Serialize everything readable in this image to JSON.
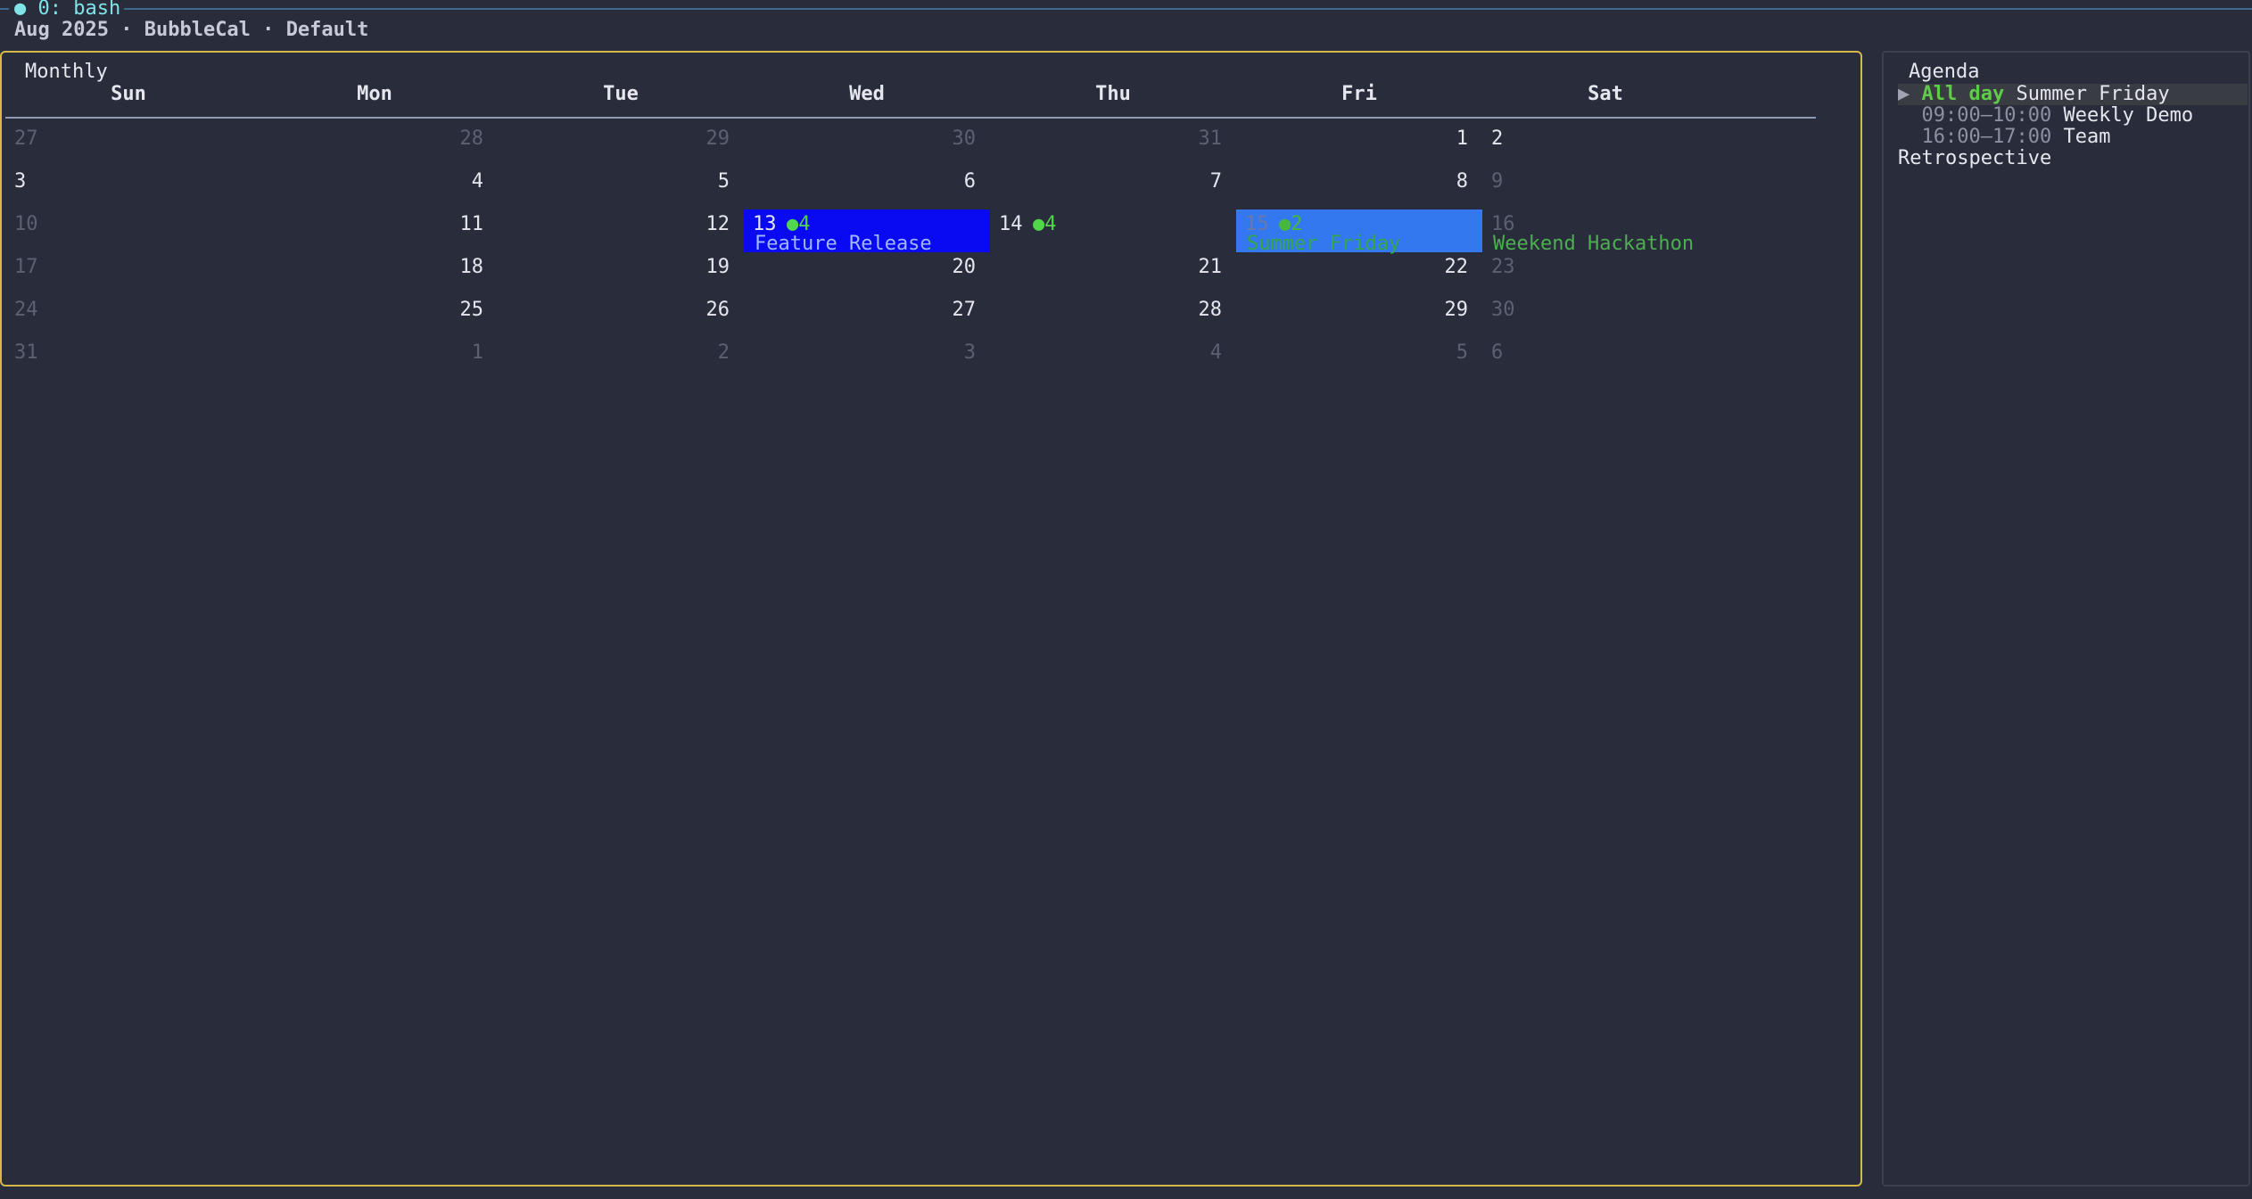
{
  "tmux": {
    "dot": "●",
    "label": "0: bash"
  },
  "status": {
    "month": "Aug 2025",
    "app": "BubbleCal",
    "profile": "Default",
    "sep": " · "
  },
  "calendar": {
    "title": "Monthly",
    "weekdays": [
      "Sun",
      "Mon",
      "Tue",
      "Wed",
      "Thu",
      "Fri",
      "Sat"
    ],
    "weeks": [
      [
        {
          "day": "27",
          "muted": true
        },
        {
          "day": "28",
          "muted": true
        },
        {
          "day": "29",
          "muted": true
        },
        {
          "day": "30",
          "muted": true
        },
        {
          "day": "31",
          "muted": true
        },
        {
          "day": "1"
        },
        {
          "day": "2"
        }
      ],
      [
        {
          "day": "3"
        },
        {
          "day": "4"
        },
        {
          "day": "5"
        },
        {
          "day": "6"
        },
        {
          "day": "7"
        },
        {
          "day": "8"
        },
        {
          "day": "9",
          "muted": true
        }
      ],
      [
        {
          "day": "10",
          "muted": true
        },
        {
          "day": "11"
        },
        {
          "day": "12"
        },
        {
          "day": "13",
          "count": "●4",
          "event": "Feature Release",
          "state": "selected"
        },
        {
          "day": "14",
          "count": "●4"
        },
        {
          "day": "15",
          "count": "●2",
          "event": "Summer Friday",
          "state": "today"
        },
        {
          "day": "16",
          "muted": true,
          "event": "Weekend Hackathon"
        }
      ],
      [
        {
          "day": "17",
          "muted": true
        },
        {
          "day": "18"
        },
        {
          "day": "19"
        },
        {
          "day": "20"
        },
        {
          "day": "21"
        },
        {
          "day": "22"
        },
        {
          "day": "23",
          "muted": true
        }
      ],
      [
        {
          "day": "24",
          "muted": true
        },
        {
          "day": "25"
        },
        {
          "day": "26"
        },
        {
          "day": "27"
        },
        {
          "day": "28"
        },
        {
          "day": "29"
        },
        {
          "day": "30",
          "muted": true
        }
      ],
      [
        {
          "day": "31",
          "muted": true
        },
        {
          "day": "1",
          "muted": true
        },
        {
          "day": "2",
          "muted": true
        },
        {
          "day": "3",
          "muted": true
        },
        {
          "day": "4",
          "muted": true
        },
        {
          "day": "5",
          "muted": true
        },
        {
          "day": "6",
          "muted": true
        }
      ]
    ]
  },
  "agenda": {
    "title": "Agenda",
    "marker": "▶",
    "items": [
      {
        "time": "All day",
        "name": "Summer Friday",
        "active": true
      },
      {
        "time": "09:00–10:00",
        "name": "Weekly Demo"
      },
      {
        "time": "16:00–17:00",
        "name": "Team"
      }
    ],
    "wrap": "Retrospective"
  },
  "colors": {
    "selected": "#0a0af2",
    "today": "#3478f0",
    "pane_border": "#d6b84a",
    "event_green": "#4caf50"
  }
}
